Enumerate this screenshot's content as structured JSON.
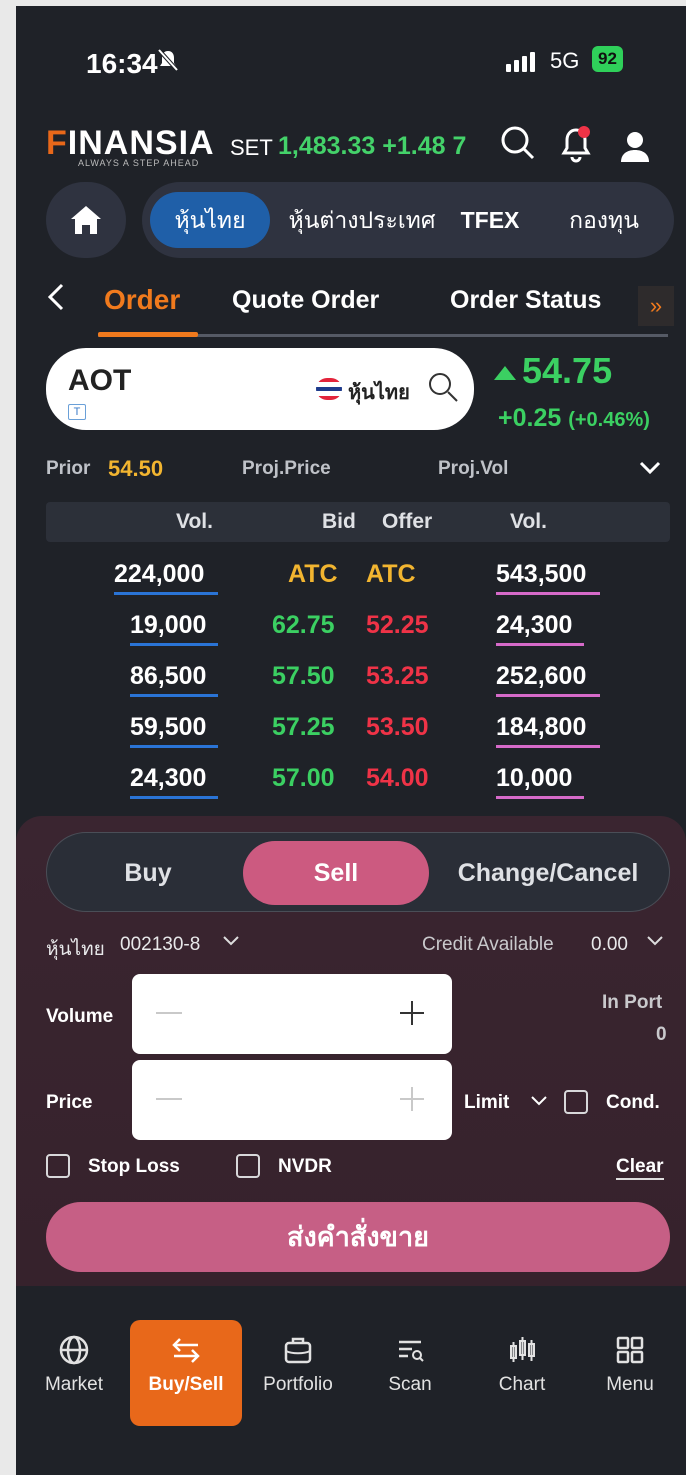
{
  "status": {
    "time": "16:34",
    "network": "5G",
    "battery": "92"
  },
  "header": {
    "logo": "FINANSIA",
    "tagline": "ALWAYS A STEP AHEAD",
    "set_label": "SET",
    "set_value": "1,483.33 +1.48 7"
  },
  "market_tabs": [
    {
      "label": "หุ้นไทย"
    },
    {
      "label": "หุ้นต่างประเทศ"
    },
    {
      "label": "TFEX"
    },
    {
      "label": "กองทุน"
    }
  ],
  "order_tabs": [
    {
      "label": "Order"
    },
    {
      "label": "Quote Order"
    },
    {
      "label": "Order Status"
    }
  ],
  "symbol": {
    "ticker": "AOT",
    "badge": "T",
    "market": "หุ้นไทย"
  },
  "quote": {
    "price": "54.75",
    "change": "+0.25",
    "change_pct": "(+0.46%)"
  },
  "stats": {
    "prior_label": "Prior",
    "prior_value": "54.50",
    "proj_price_label": "Proj.Price",
    "proj_vol_label": "Proj.Vol"
  },
  "orderbook": {
    "headers": {
      "bid_vol": "Vol.",
      "bid": "Bid",
      "offer": "Offer",
      "offer_vol": "Vol."
    },
    "rows": [
      {
        "bid_vol": "224,000",
        "bid": "ATC",
        "offer": "ATC",
        "offer_vol": "543,500"
      },
      {
        "bid_vol": "19,000",
        "bid": "62.75",
        "offer": "52.25",
        "offer_vol": "24,300"
      },
      {
        "bid_vol": "86,500",
        "bid": "57.50",
        "offer": "53.25",
        "offer_vol": "252,600"
      },
      {
        "bid_vol": "59,500",
        "bid": "57.25",
        "offer": "53.50",
        "offer_vol": "184,800"
      },
      {
        "bid_vol": "24,300",
        "bid": "57.00",
        "offer": "54.00",
        "offer_vol": "10,000"
      }
    ]
  },
  "side": {
    "buy": "Buy",
    "sell": "Sell",
    "change": "Change/Cancel"
  },
  "account": {
    "market": "หุ้นไทย",
    "number": "002130-8",
    "credit_label": "Credit Available",
    "credit_value": "0.00"
  },
  "form": {
    "volume_label": "Volume",
    "price_label": "Price",
    "in_port_label": "In Port",
    "in_port_value": "0",
    "order_type": "Limit",
    "cond_label": "Cond.",
    "stop_loss_label": "Stop Loss",
    "nvdr_label": "NVDR",
    "clear_label": "Clear",
    "submit_label": "ส่งคำสั่งขาย"
  },
  "bottom_nav": [
    {
      "label": "Market"
    },
    {
      "label": "Buy/Sell"
    },
    {
      "label": "Portfolio"
    },
    {
      "label": "Scan"
    },
    {
      "label": "Chart"
    },
    {
      "label": "Menu"
    }
  ],
  "colors": {
    "bg": "#1f2228",
    "accent": "#e8681a",
    "up": "#3bd062",
    "down": "#ef3347",
    "sell": "#cc5a80",
    "active_tab": "#1f5fa8"
  }
}
